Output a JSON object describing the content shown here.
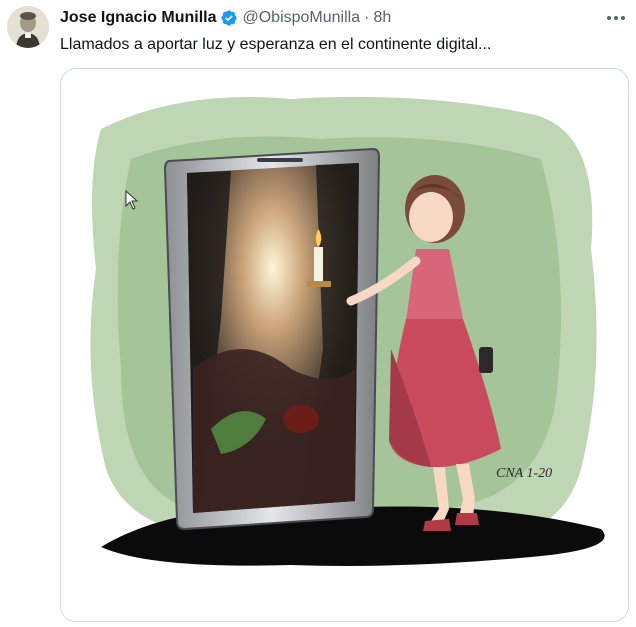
{
  "tweet": {
    "author_name": "Jose Ignacio Munilla",
    "handle": "@ObispoMunilla",
    "separator": "·",
    "time": "8h",
    "text": "Llamados a aportar luz y esperanza en el continente digital...",
    "verified": true,
    "verified_color": "#1d9bf0"
  },
  "icons": {
    "more": "more-dots-icon",
    "verified": "verified-badge-icon",
    "cursor": "mouse-pointer-icon"
  },
  "media": {
    "signature": "CNA 1-20"
  },
  "colors": {
    "text_primary": "#0f1419",
    "text_secondary": "#536471",
    "border": "#cfd9de"
  }
}
